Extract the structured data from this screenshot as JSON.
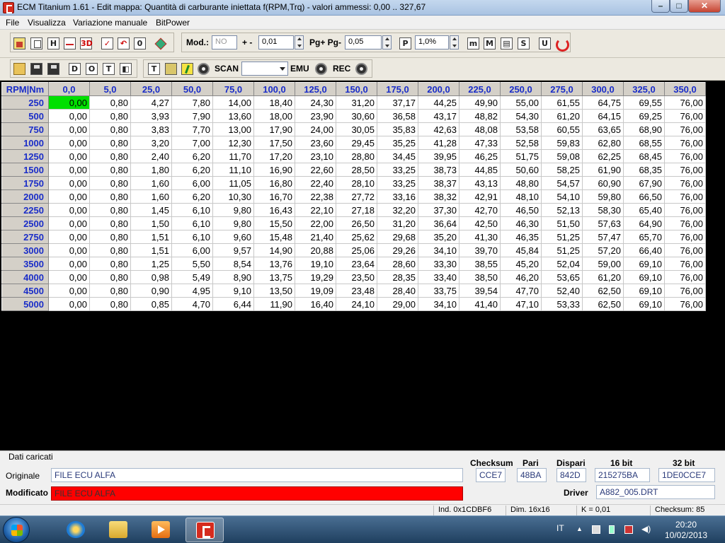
{
  "window": {
    "title": "ECM Titanium 1.61 - Edit mappa: Quantità di carburante iniettata f(RPM,Trq) - valori ammessi: 0,00 .. 327,67",
    "minimize": "–",
    "maximize": "□",
    "close": "✕"
  },
  "menu": {
    "items": [
      "File",
      "Visualizza",
      "Variazione manuale",
      "BitPower"
    ]
  },
  "toolbar1": {
    "mod_label": "Mod.:",
    "mod_value": "NO",
    "plusminus_label": "+ -",
    "plusminus_value": "0,01",
    "pg_label": "Pg+ Pg-",
    "pg_value": "0,05",
    "percent_value": "1,0%",
    "icons": [
      "house-icon",
      "copy-icon",
      "h-icon",
      "curve-icon",
      "3d-icon",
      "check-icon",
      "undo-icon",
      "zero-icon",
      "diamond-icon",
      "p-icon",
      "m-small-icon",
      "m-icon",
      "grid-icon",
      "s-icon",
      "u-icon",
      "power-icon"
    ]
  },
  "toolbar2": {
    "scan_label": "SCAN",
    "scan_value": "",
    "emu_label": "EMU",
    "rec_label": "REC",
    "icons": [
      "open-folder-icon",
      "save-icon",
      "save-as-icon",
      "d-icon",
      "o-icon",
      "t-icon",
      "split-icon",
      "t2-icon",
      "lock-icon",
      "run-icon",
      "record-icon"
    ]
  },
  "map": {
    "corner": "RPM|Nm",
    "columns": [
      "0,0",
      "5,0",
      "25,0",
      "50,0",
      "75,0",
      "100,0",
      "125,0",
      "150,0",
      "175,0",
      "200,0",
      "225,0",
      "250,0",
      "275,0",
      "300,0",
      "325,0",
      "350,0"
    ],
    "rows": [
      {
        "rpm": "250",
        "values": [
          "0,00",
          "0,80",
          "4,27",
          "7,80",
          "14,00",
          "18,40",
          "24,30",
          "31,20",
          "37,17",
          "44,25",
          "49,90",
          "55,00",
          "61,55",
          "64,75",
          "69,55",
          "76,00"
        ]
      },
      {
        "rpm": "500",
        "values": [
          "0,00",
          "0,80",
          "3,93",
          "7,90",
          "13,60",
          "18,00",
          "23,90",
          "30,60",
          "36,58",
          "43,17",
          "48,82",
          "54,30",
          "61,20",
          "64,15",
          "69,25",
          "76,00"
        ]
      },
      {
        "rpm": "750",
        "values": [
          "0,00",
          "0,80",
          "3,83",
          "7,70",
          "13,00",
          "17,90",
          "24,00",
          "30,05",
          "35,83",
          "42,63",
          "48,08",
          "53,58",
          "60,55",
          "63,65",
          "68,90",
          "76,00"
        ]
      },
      {
        "rpm": "1000",
        "values": [
          "0,00",
          "0,80",
          "3,20",
          "7,00",
          "12,30",
          "17,50",
          "23,60",
          "29,45",
          "35,25",
          "41,28",
          "47,33",
          "52,58",
          "59,83",
          "62,80",
          "68,55",
          "76,00"
        ]
      },
      {
        "rpm": "1250",
        "values": [
          "0,00",
          "0,80",
          "2,40",
          "6,20",
          "11,70",
          "17,20",
          "23,10",
          "28,80",
          "34,45",
          "39,95",
          "46,25",
          "51,75",
          "59,08",
          "62,25",
          "68,45",
          "76,00"
        ]
      },
      {
        "rpm": "1500",
        "values": [
          "0,00",
          "0,80",
          "1,80",
          "6,20",
          "11,10",
          "16,90",
          "22,60",
          "28,50",
          "33,25",
          "38,73",
          "44,85",
          "50,60",
          "58,25",
          "61,90",
          "68,35",
          "76,00"
        ]
      },
      {
        "rpm": "1750",
        "values": [
          "0,00",
          "0,80",
          "1,60",
          "6,00",
          "11,05",
          "16,80",
          "22,40",
          "28,10",
          "33,25",
          "38,37",
          "43,13",
          "48,80",
          "54,57",
          "60,90",
          "67,90",
          "76,00"
        ]
      },
      {
        "rpm": "2000",
        "values": [
          "0,00",
          "0,80",
          "1,60",
          "6,20",
          "10,30",
          "16,70",
          "22,38",
          "27,72",
          "33,16",
          "38,32",
          "42,91",
          "48,10",
          "54,10",
          "59,80",
          "66,50",
          "76,00"
        ]
      },
      {
        "rpm": "2250",
        "values": [
          "0,00",
          "0,80",
          "1,45",
          "6,10",
          "9,80",
          "16,43",
          "22,10",
          "27,18",
          "32,20",
          "37,30",
          "42,70",
          "46,50",
          "52,13",
          "58,30",
          "65,40",
          "76,00"
        ]
      },
      {
        "rpm": "2500",
        "values": [
          "0,00",
          "0,80",
          "1,50",
          "6,10",
          "9,80",
          "15,50",
          "22,00",
          "26,50",
          "31,20",
          "36,64",
          "42,50",
          "46,30",
          "51,50",
          "57,63",
          "64,90",
          "76,00"
        ]
      },
      {
        "rpm": "2750",
        "values": [
          "0,00",
          "0,80",
          "1,51",
          "6,10",
          "9,60",
          "15,48",
          "21,40",
          "25,62",
          "29,68",
          "35,20",
          "41,30",
          "46,35",
          "51,25",
          "57,47",
          "65,70",
          "76,00"
        ]
      },
      {
        "rpm": "3000",
        "values": [
          "0,00",
          "0,80",
          "1,51",
          "6,00",
          "9,57",
          "14,90",
          "20,88",
          "25,06",
          "29,26",
          "34,10",
          "39,70",
          "45,84",
          "51,25",
          "57,20",
          "66,40",
          "76,00"
        ]
      },
      {
        "rpm": "3500",
        "values": [
          "0,00",
          "0,80",
          "1,25",
          "5,50",
          "8,54",
          "13,76",
          "19,10",
          "23,64",
          "28,60",
          "33,30",
          "38,55",
          "45,20",
          "52,04",
          "59,00",
          "69,10",
          "76,00"
        ]
      },
      {
        "rpm": "4000",
        "values": [
          "0,00",
          "0,80",
          "0,98",
          "5,49",
          "8,90",
          "13,75",
          "19,29",
          "23,50",
          "28,35",
          "33,40",
          "38,50",
          "46,20",
          "53,65",
          "61,20",
          "69,10",
          "76,00"
        ]
      },
      {
        "rpm": "4500",
        "values": [
          "0,00",
          "0,80",
          "0,90",
          "4,95",
          "9,10",
          "13,50",
          "19,09",
          "23,48",
          "28,40",
          "33,75",
          "39,54",
          "47,70",
          "52,40",
          "62,50",
          "69,10",
          "76,00"
        ]
      },
      {
        "rpm": "5000",
        "values": [
          "0,00",
          "0,80",
          "0,85",
          "4,70",
          "6,44",
          "11,90",
          "16,40",
          "24,10",
          "29,00",
          "34,10",
          "41,40",
          "47,10",
          "53,33",
          "62,50",
          "69,10",
          "76,00"
        ]
      }
    ],
    "selected_cell_color": "#00e000"
  },
  "loaded": {
    "section_title": "Dati caricati",
    "original_label": "Originale",
    "original_value": "FILE ECU ALFA",
    "modified_label": "Modificato",
    "modified_value": "FILE ECU ALFA",
    "modified_color": "#ff0000",
    "checksum_label": "Checksum",
    "checksum_value": "CCE7",
    "pari_label": "Pari",
    "pari_value": "48BA",
    "dispari_label": "Dispari",
    "dispari_value": "842D",
    "bit16_label": "16 bit",
    "bit16_value": "215275BA",
    "bit32_label": "32 bit",
    "bit32_value": "1DE0CCE7",
    "driver_label": "Driver",
    "driver_value": "A882_005.DRT"
  },
  "status": {
    "ind": "Ind. 0x1CDBF6",
    "dim": "Dim. 16x16",
    "k": "K = 0,01",
    "checksum": "Checksum: 85"
  },
  "taskbar": {
    "language": "IT",
    "time": "20:20",
    "date": "10/02/2013"
  }
}
